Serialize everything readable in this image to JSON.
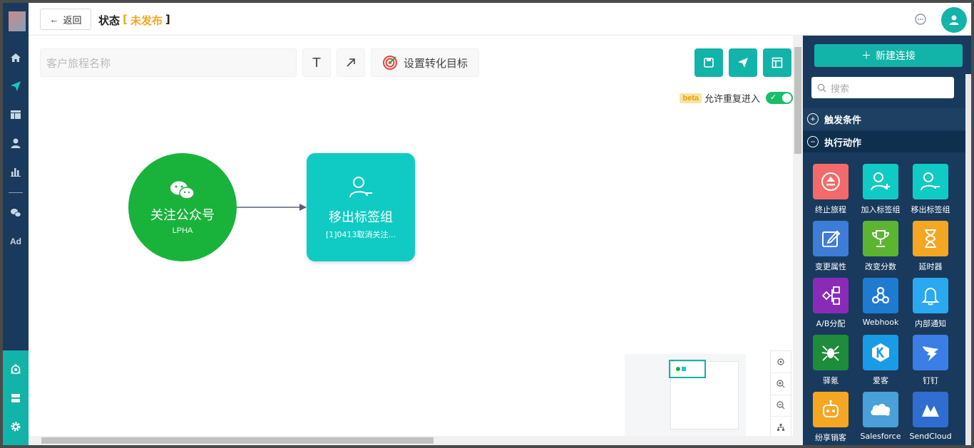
{
  "header": {
    "back_label": "返回",
    "status_label": "状态",
    "status_open": "[",
    "status_value": "未发布",
    "status_close": "]"
  },
  "toolbar": {
    "name_placeholder": "客户旅程名称",
    "text_tool": "T",
    "goal_label": "设置转化目标",
    "beta_tag": "beta",
    "allow_reentry_label": "允许重复进入",
    "allow_reentry": true
  },
  "nodes": {
    "trigger": {
      "title": "关注公众号",
      "subtitle": "LPHA"
    },
    "action": {
      "title": "移出标签组",
      "subtitle": "[1]0413取消关注..."
    }
  },
  "panel": {
    "new_connection_label": "新建连接",
    "search_placeholder": "搜索",
    "sections": [
      {
        "label": "触发条件",
        "state": "collapsed"
      },
      {
        "label": "执行动作",
        "state": "expanded"
      }
    ],
    "actions": [
      {
        "label": "终止旅程",
        "icon": "eject-icon",
        "color": "#f46a6a"
      },
      {
        "label": "加入标签组",
        "icon": "user-plus-icon",
        "color": "#10cbc4"
      },
      {
        "label": "移出标签组",
        "icon": "user-minus-icon",
        "color": "#10cbc4"
      },
      {
        "label": "变更属性",
        "icon": "edit-icon",
        "color": "#3d7dd8"
      },
      {
        "label": "改变分数",
        "icon": "trophy-icon",
        "color": "#5cb531"
      },
      {
        "label": "延时器",
        "icon": "hourglass-icon",
        "color": "#f5a623"
      },
      {
        "label": "A/B分配",
        "icon": "ab-split-icon",
        "color": "#8a2bb8"
      },
      {
        "label": "Webhook",
        "icon": "webhook-icon",
        "color": "#1f7bd0"
      },
      {
        "label": "内部通知",
        "icon": "bell-icon",
        "color": "#2aa8f0"
      },
      {
        "label": "驿氪",
        "icon": "spider-icon",
        "color": "#1e8c3a"
      },
      {
        "label": "爱客",
        "icon": "k-logo-icon",
        "color": "#1a9be6"
      },
      {
        "label": "钉钉",
        "icon": "dingtalk-icon",
        "color": "#3a7ee6"
      },
      {
        "label": "纷享销客",
        "icon": "bot-icon",
        "color": "#f5a623"
      },
      {
        "label": "Salesforce",
        "icon": "cloud-icon",
        "color": "#4aa0d8"
      },
      {
        "label": "SendCloud",
        "icon": "sendcloud-icon",
        "color": "#2f6ed0"
      }
    ]
  },
  "leftnav": {
    "ad_label": "Ad"
  },
  "colors": {
    "accent": "#12b3a8",
    "nav": "#193a5c",
    "status": "#f5a623",
    "trigger_node": "#19b33c",
    "action_node": "#10cbc4"
  }
}
